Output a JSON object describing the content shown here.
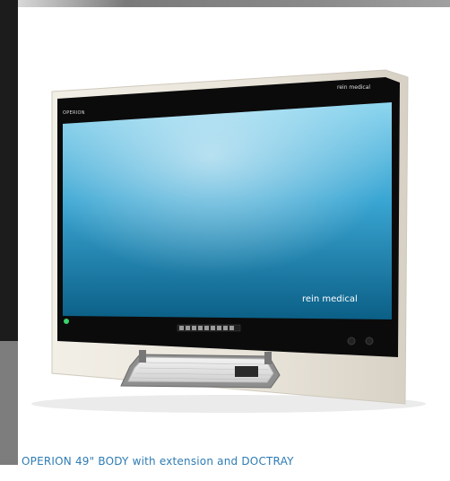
{
  "product": {
    "model_label": "OPERION",
    "brand_top": "rein medical",
    "brand_screen": "rein medical"
  },
  "caption": "OPERION 49\" BODY with extension and DOCTRAY",
  "colors": {
    "caption": "#2e7cb4",
    "bezel": "#0b0b0b",
    "frame": "#e7e2d6",
    "screen_light": "#8fd6ef",
    "screen_dark": "#0b5f86",
    "power_led": "#3bd36b"
  },
  "icons": [
    "power-led-icon",
    "control-button-icon"
  ]
}
